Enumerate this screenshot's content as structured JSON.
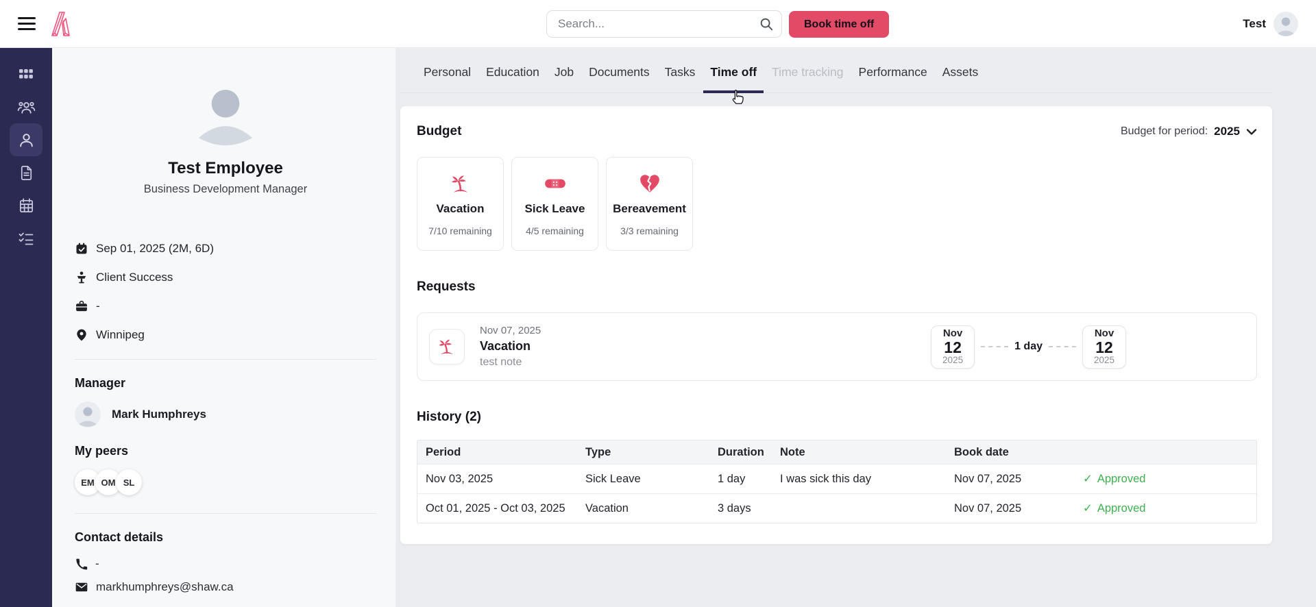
{
  "topbar": {
    "search_placeholder": "Search...",
    "book_label": "Book time off",
    "user_name": "Test"
  },
  "sidebar": {
    "items": [
      {
        "name": "apps",
        "active": false
      },
      {
        "name": "team",
        "active": false
      },
      {
        "name": "employee",
        "active": true
      },
      {
        "name": "documents",
        "active": false
      },
      {
        "name": "calendar",
        "active": false
      },
      {
        "name": "tasks",
        "active": false
      }
    ]
  },
  "profile": {
    "name": "Test Employee",
    "title": "Business Development Manager",
    "details": [
      {
        "icon": "calendar-check",
        "text": "Sep 01, 2025 (2M, 6D)"
      },
      {
        "icon": "department",
        "text": "Client Success"
      },
      {
        "icon": "briefcase",
        "text": "-"
      },
      {
        "icon": "location-pin",
        "text": "Winnipeg"
      }
    ],
    "manager_label": "Manager",
    "manager_name": "Mark Humphreys",
    "peers_label": "My peers",
    "peers": [
      "EM",
      "OM",
      "SL"
    ],
    "contact_label": "Contact details",
    "phone_value": "-",
    "email_value": "markhumphreys@shaw.ca"
  },
  "tabs": [
    {
      "label": "Personal",
      "state": "normal"
    },
    {
      "label": "Education",
      "state": "normal"
    },
    {
      "label": "Job",
      "state": "normal"
    },
    {
      "label": "Documents",
      "state": "normal"
    },
    {
      "label": "Tasks",
      "state": "normal"
    },
    {
      "label": "Time off",
      "state": "active"
    },
    {
      "label": "Time tracking",
      "state": "disabled"
    },
    {
      "label": "Performance",
      "state": "normal"
    },
    {
      "label": "Assets",
      "state": "normal"
    }
  ],
  "timeoff": {
    "budget": {
      "heading": "Budget",
      "period_label": "Budget for period:",
      "period_value": "2025",
      "cards": [
        {
          "icon": "palm-tree",
          "label": "Vacation",
          "remaining": "7/10 remaining"
        },
        {
          "icon": "bandage",
          "label": "Sick Leave",
          "remaining": "4/5 remaining"
        },
        {
          "icon": "broken-heart",
          "label": "Bereavement",
          "remaining": "3/3 remaining"
        }
      ]
    },
    "requests": {
      "heading": "Requests",
      "items": [
        {
          "date": "Nov 07, 2025",
          "type": "Vacation",
          "note": "test note",
          "start": {
            "month": "Nov",
            "day": "12",
            "year": "2025"
          },
          "duration": "1 day",
          "end": {
            "month": "Nov",
            "day": "12",
            "year": "2025"
          }
        }
      ]
    },
    "history": {
      "heading": "History (2)",
      "check_glyph": "✓",
      "columns": [
        "Period",
        "Type",
        "Duration",
        "Note",
        "Book date"
      ],
      "rows": [
        {
          "period": "Nov 03, 2025",
          "type": "Sick Leave",
          "duration": "1 day",
          "note": "I was sick this day",
          "book_date": "Nov 07, 2025",
          "status": "Approved"
        },
        {
          "period": "Oct 01, 2025 - Oct 03, 2025",
          "type": "Vacation",
          "duration": "3 days",
          "note": "",
          "book_date": "Nov 07, 2025",
          "status": "Approved"
        }
      ]
    }
  },
  "colors": {
    "accent_pink": "#e24a66",
    "sidebar_navy": "#2b2a52",
    "approved_green": "#3fb04f",
    "tab_underline": "#2b2a52",
    "page_bg": "#ecedf1"
  }
}
